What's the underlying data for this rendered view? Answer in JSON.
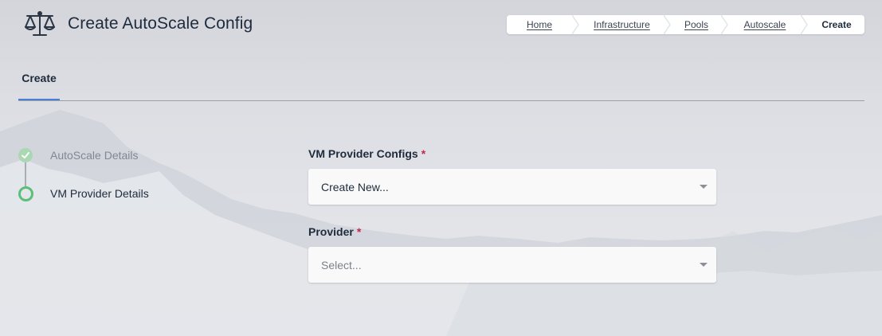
{
  "header": {
    "title": "Create AutoScale Config",
    "icon": "scale-balance-icon"
  },
  "breadcrumb": {
    "items": [
      "Home",
      "Infrastructure",
      "Pools",
      "Autoscale",
      "Create"
    ]
  },
  "tabs": [
    {
      "label": "Create",
      "active": true
    }
  ],
  "stepper": {
    "steps": [
      {
        "label": "AutoScale Details",
        "state": "completed"
      },
      {
        "label": "VM Provider Details",
        "state": "current"
      }
    ]
  },
  "form": {
    "vm_provider_configs": {
      "label": "VM Provider Configs",
      "required_marker": "*",
      "value": "Create New..."
    },
    "provider": {
      "label": "Provider",
      "required_marker": "*",
      "placeholder": "Select..."
    }
  },
  "colors": {
    "accent": "#4a7fd8",
    "step_complete": "#a9d8b3",
    "step_current": "#5bbf7a",
    "required": "#c3284f"
  }
}
